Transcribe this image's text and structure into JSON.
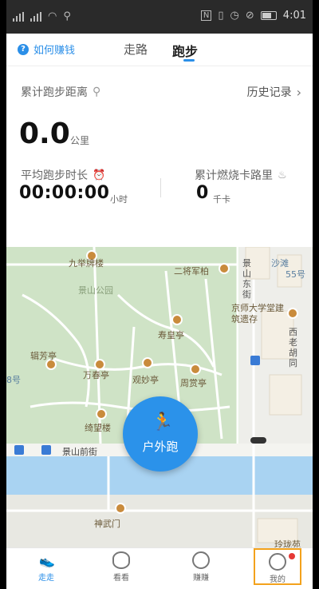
{
  "status_bar": {
    "time": "4:01"
  },
  "top_bar": {
    "help_label": "如何赚钱",
    "tabs": [
      {
        "label": "走路",
        "active": false
      },
      {
        "label": "跑步",
        "active": true
      }
    ]
  },
  "stats": {
    "total_distance_label": "累计跑步距离",
    "history_label": "历史记录",
    "distance_value": "0.0",
    "distance_unit": "公里",
    "avg_time_label": "平均跑步时长",
    "avg_time_value": "00:00:00",
    "avg_time_unit": "小时",
    "calories_label": "累计燃烧卡路里",
    "calories_value": "0",
    "calories_unit": "千卡"
  },
  "map": {
    "poi": [
      "九举牌楼",
      "二将军柏",
      "景山公园",
      "寿皇亭",
      "辑芳亭",
      "万春亭",
      "观妙亭",
      "周赏亭",
      "绮望楼",
      "神武门",
      "京师大学堂建筑遗存",
      "沙滩",
      "55号",
      "玲珑苑"
    ],
    "streets": [
      "景山前街",
      "景山东街",
      "西老胡同",
      "8号"
    ],
    "run_button_label": "户外跑"
  },
  "bottom_nav": {
    "items": [
      {
        "label": "走走",
        "active": true
      },
      {
        "label": "看看",
        "active": false
      },
      {
        "label": "赚赚",
        "active": false
      },
      {
        "label": "我的",
        "active": false,
        "badge": true
      }
    ]
  },
  "colors": {
    "accent": "#2b8fe8",
    "map_green": "#cfe3c6",
    "water": "#a9d3f2",
    "poi": "#c98b3c"
  }
}
